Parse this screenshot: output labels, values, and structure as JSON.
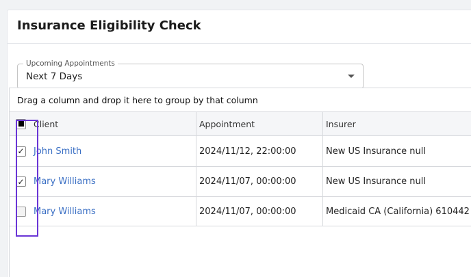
{
  "page": {
    "title": "Insurance Eligibility Check"
  },
  "filter": {
    "legend": "Upcoming Appointments",
    "value": "Next 7 Days"
  },
  "grid": {
    "group_hint": "Drag a column and drop it here to group by that column",
    "columns": [
      "Client",
      "Appointment",
      "Insurer"
    ],
    "rows": [
      {
        "client": "John Smith",
        "appointment": "2024/11/12, 22:00:00",
        "insurer": "New US Insurance null",
        "checked": true
      },
      {
        "client": "Mary Williams",
        "appointment": "2024/11/07, 00:00:00",
        "insurer": "New US Insurance null",
        "checked": true
      },
      {
        "client": "Mary Williams",
        "appointment": "2024/11/07, 00:00:00",
        "insurer": "Medicaid CA (California) 610442",
        "checked": false
      }
    ],
    "select_all_state": "indeterminate"
  },
  "colors": {
    "link": "#3a6fc4",
    "highlight": "#6a35d6"
  },
  "icons": {
    "check": "✓"
  }
}
